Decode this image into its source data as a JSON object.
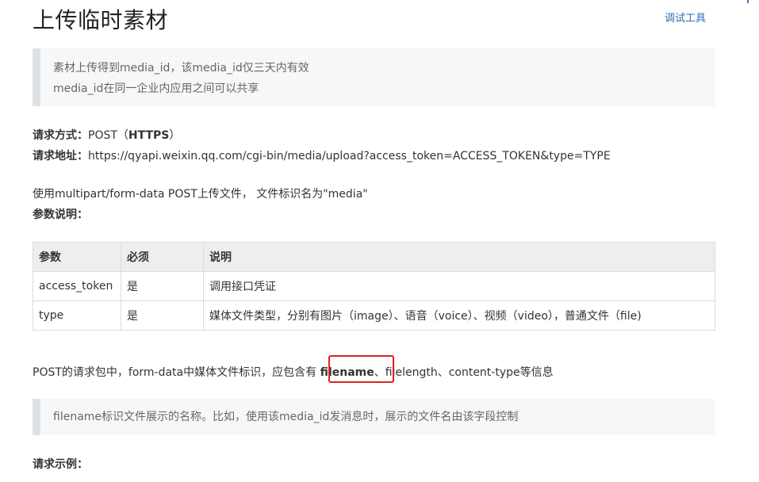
{
  "title": "上传临时素材",
  "debug_link": "调试工具",
  "note1": [
    "素材上传得到media_id，该media_id仅三天内有效",
    "media_id在同一企业内应用之间可以共享"
  ],
  "method": {
    "label": "请求方式：",
    "value": "POST（",
    "https": "HTTPS",
    "close": "）"
  },
  "address": {
    "label": "请求地址：",
    "value": "https://qyapi.weixin.qq.com/cgi-bin/media/upload?access_token=ACCESS_TOKEN&type=TYPE"
  },
  "upload_desc": "使用multipart/form-data POST上传文件， 文件标识名为\"media\"",
  "params_label": "参数说明：",
  "table": {
    "headers": [
      "参数",
      "必须",
      "说明"
    ],
    "rows": [
      [
        "access_token",
        "是",
        "调用接口凭证"
      ],
      [
        "type",
        "是",
        "媒体文件类型，分别有图片（image）、语音（voice）、视频（video），普通文件（file)"
      ]
    ]
  },
  "post_info": {
    "before": "POST的请求包中，form-data中媒体文件标识，应包含有 ",
    "filename": "filename",
    "after": "、filelength、content-type等信息"
  },
  "note2": "filename标识文件展示的名称。比如，使用该media_id发消息时，展示的文件名由该字段控制",
  "example_label": "请求示例："
}
